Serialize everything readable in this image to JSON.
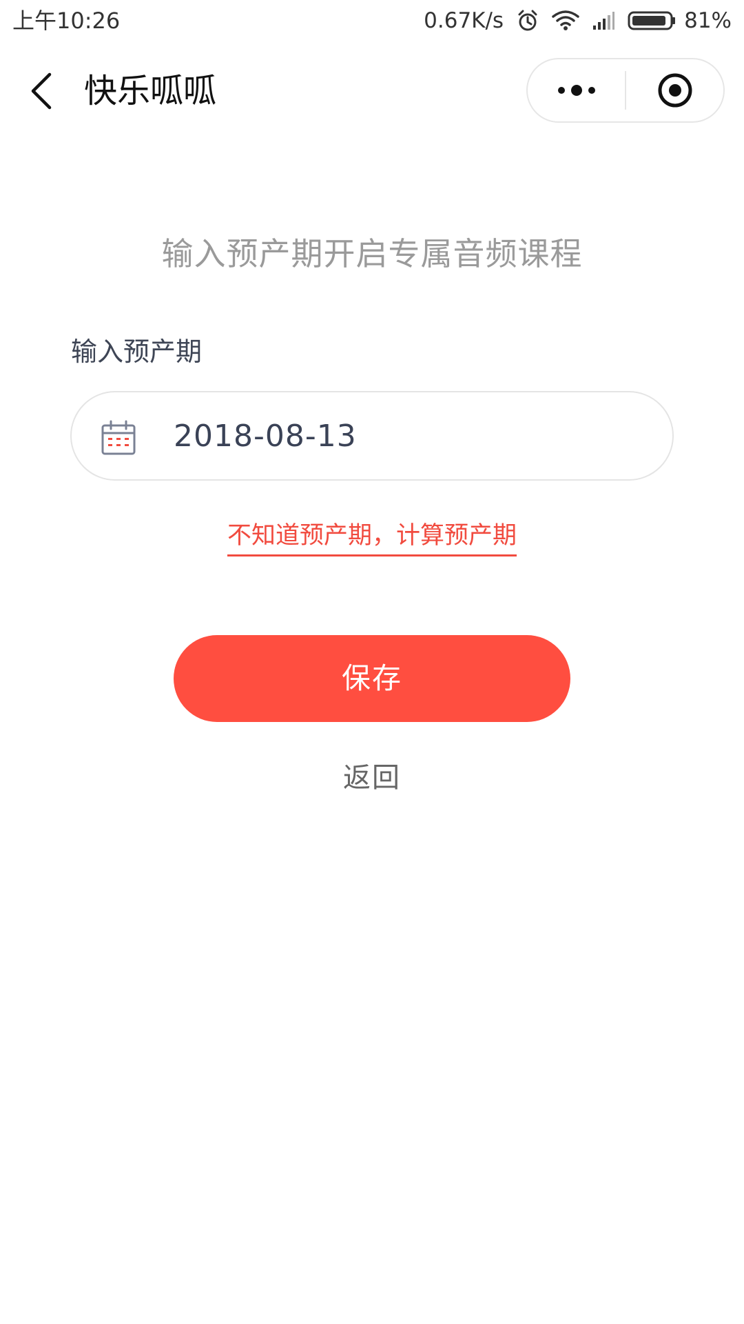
{
  "status_bar": {
    "time": "上午10:26",
    "network_speed": "0.67K/s",
    "battery_percent": "81%",
    "icons": [
      "alarm-icon",
      "wifi-icon",
      "signal-icon",
      "battery-icon"
    ]
  },
  "nav": {
    "title": "快乐呱呱",
    "back_icon": "chevron-left-icon",
    "more_icon": "more-dots-icon",
    "close_icon": "target-close-icon"
  },
  "main": {
    "headline": "输入预产期开启专属音频课程",
    "field_label": "输入预产期",
    "date_icon": "calendar-icon",
    "date_value": "2018-08-13",
    "calc_link": "不知道预产期，计算预产期",
    "save_label": "保存",
    "back_label": "返回"
  },
  "colors": {
    "accent": "#ff4e40",
    "link": "#f14b3f",
    "muted_text": "#9a9a9a",
    "label_text": "#3e4555"
  }
}
